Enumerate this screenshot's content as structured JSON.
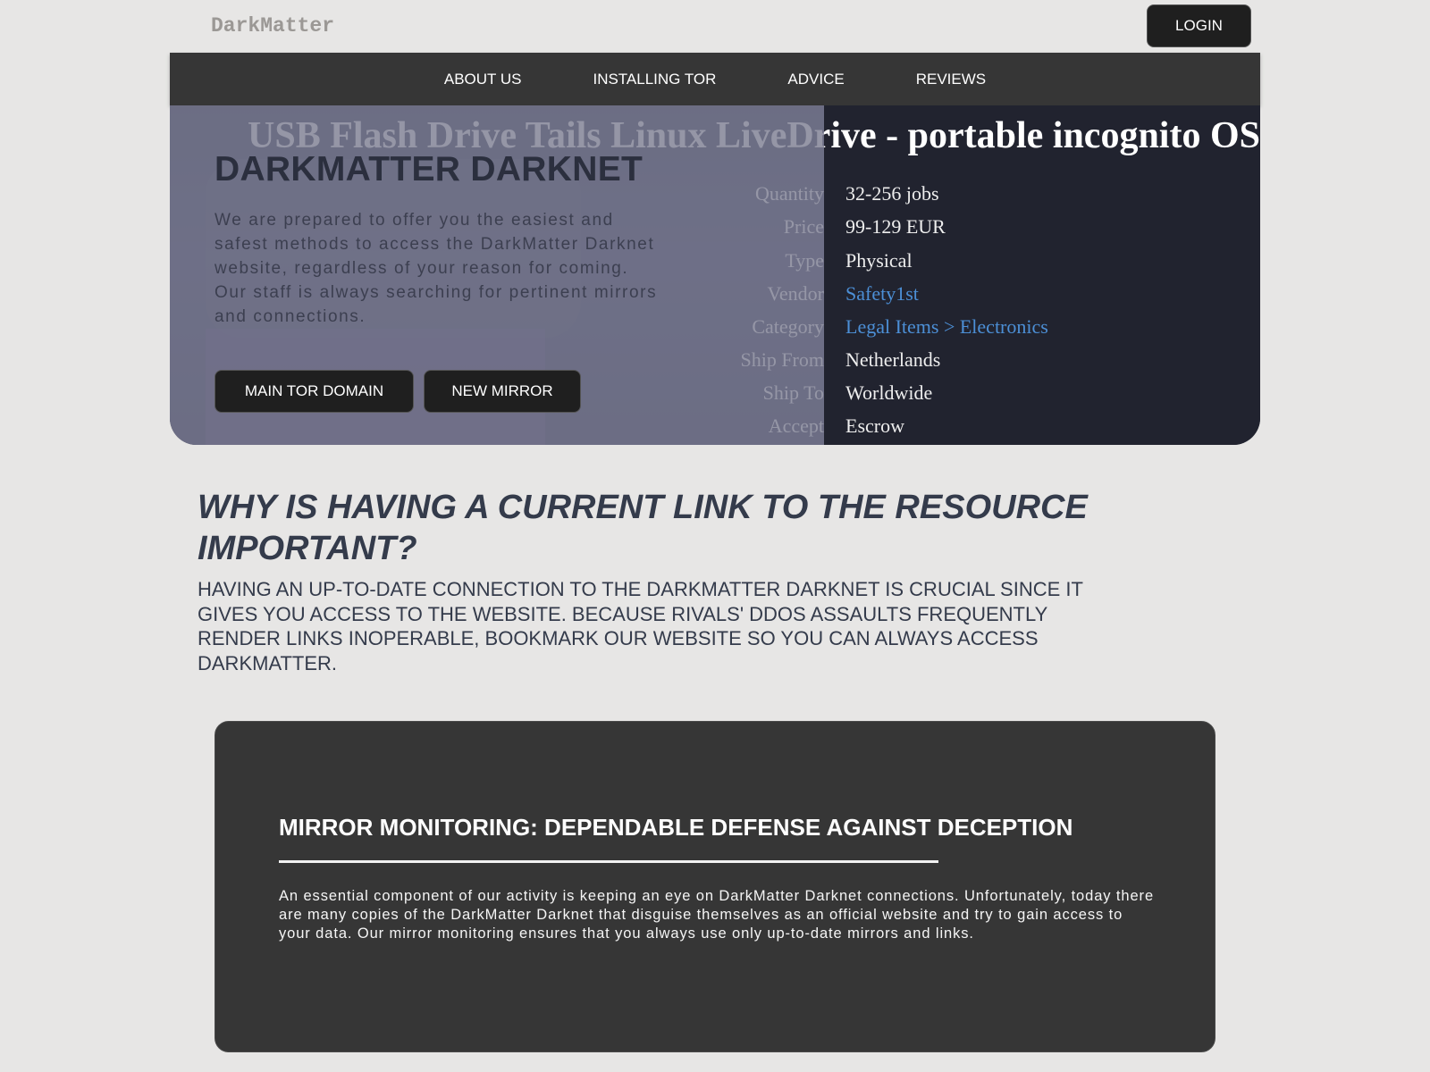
{
  "header": {
    "brand": "DarkMatter",
    "login_label": "LOGIN"
  },
  "nav": {
    "items": [
      {
        "label": "ABOUT US"
      },
      {
        "label": "INSTALLING TOR"
      },
      {
        "label": "ADVICE"
      },
      {
        "label": "REVIEWS"
      }
    ]
  },
  "hero": {
    "banner_text": "USB Flash Drive Tails Linux LiveDrive - portable incognito OS",
    "specs": [
      {
        "key": "Quantity",
        "value": "32-256 jobs",
        "link": false
      },
      {
        "key": "Price",
        "value": "99-129 EUR",
        "link": false
      },
      {
        "key": "Type",
        "value": "Physical",
        "link": false
      },
      {
        "key": "Vendor",
        "value": "Safety1st",
        "link": true
      },
      {
        "key": "Category",
        "value": "Legal Items > Electronics",
        "link": true
      },
      {
        "key": "Ship From",
        "value": "Netherlands",
        "link": false
      },
      {
        "key": "Ship To",
        "value": "Worldwide",
        "link": false
      },
      {
        "key": "Accept",
        "value": "Escrow",
        "link": false
      }
    ],
    "title": "DARKMATTER DARKNET",
    "description": "We are prepared to offer you the easiest and safest methods to access the DarkMatter Darknet website, regardless of your reason for coming. Our staff is always searching for pertinent mirrors and connections.",
    "button_main": "MAIN TOR DOMAIN",
    "button_mirror": "NEW MIRROR"
  },
  "why": {
    "title": "WHY IS HAVING A CURRENT LINK TO THE RESOURCE IMPORTANT?",
    "text": "Having an up-to-date connection to the DarkMatter Darknet is crucial since it gives you access to the website. Because rivals' DDoS assaults frequently render links inoperable, bookmark our website so you can always access DarkMatter."
  },
  "card": {
    "title": "MIRROR MONITORING: DEPENDABLE DEFENSE AGAINST DECEPTION",
    "text": "An essential component of our activity is keeping an eye on DarkMatter Darknet connections. Unfortunately, today there are many copies of the DarkMatter Darknet that disguise themselves as an official website and try to gain access to your data. Our mirror monitoring ensures that you always use only up-to-date mirrors and links."
  },
  "colors": {
    "background": "#e7e6e5",
    "nav_bg": "#363636",
    "button_bg": "#1f1f1f",
    "link": "#4c8fd6",
    "heading": "#343b4b"
  }
}
